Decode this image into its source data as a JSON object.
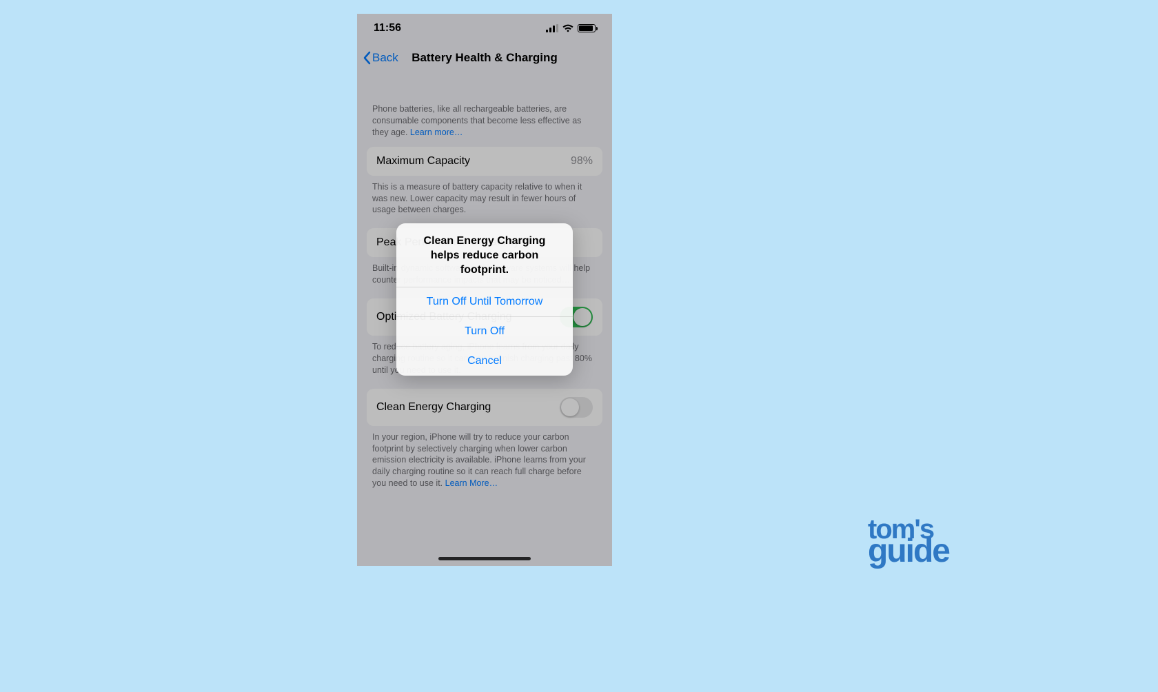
{
  "status": {
    "time": "11:56"
  },
  "nav": {
    "back": "Back",
    "title": "Battery Health & Charging"
  },
  "intro": {
    "text": "Phone batteries, like all rechargeable batteries, are consumable components that become less effective as they age. ",
    "learn_more": "Learn more…"
  },
  "capacity": {
    "label": "Maximum Capacity",
    "value": "98%",
    "note": "This is a measure of battery capacity relative to when it was new. Lower capacity may result in fewer hours of usage between charges."
  },
  "peak": {
    "label": "Peak Performance Capability",
    "note": "Built-in dynamic software and hardware systems will help counter performance impacts that may be noticed…"
  },
  "optimized": {
    "label": "Optimized Battery Charging",
    "note": "To reduce battery aging, iPhone learns from your daily charging routine so it can wait to finish charging past 80% until you need to use it.",
    "on": true
  },
  "clean": {
    "label": "Clean Energy Charging",
    "note": "In your region, iPhone will try to reduce your carbon footprint by selectively charging when lower carbon emission electricity is available. iPhone learns from your daily charging routine so it can reach full charge before you need to use it. ",
    "learn_more": "Learn More…",
    "on": false
  },
  "sheet": {
    "title": "Clean Energy Charging helps reduce carbon footprint.",
    "option1": "Turn Off Until Tomorrow",
    "option2": "Turn Off",
    "cancel": "Cancel"
  },
  "branding": {
    "line1": "tom's",
    "line2": "guide"
  }
}
